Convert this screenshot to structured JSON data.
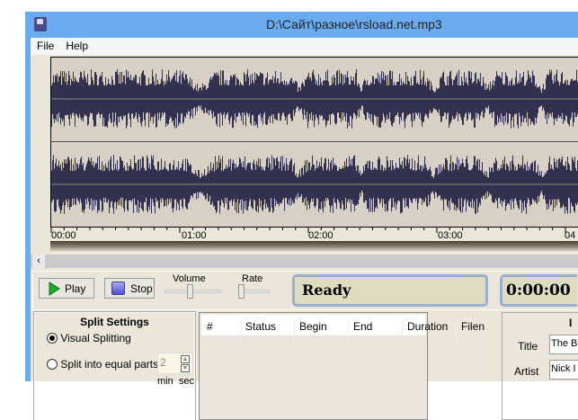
{
  "window": {
    "title": "D:\\Сайт\\разное\\rsload.net.mp3"
  },
  "menu": [
    "File",
    "Help"
  ],
  "timeline": {
    "ticks": [
      "00:00",
      "01:00",
      "02:00",
      "03:00",
      "04"
    ]
  },
  "controls": {
    "play": "Play",
    "stop": "Stop",
    "volume_label": "Volume",
    "rate_label": "Rate",
    "volume": 0.5,
    "rate": 0.05,
    "status": "Ready",
    "time": "0:00:00"
  },
  "split_settings": {
    "title": "Split Settings",
    "visual": "Visual Splitting",
    "equal": "Split into equal parts",
    "parts_value": "2",
    "min": "min",
    "sec": "sec"
  },
  "segments": {
    "columns": [
      "#",
      "Status",
      "Begin",
      "End",
      "Duration",
      "Filen"
    ]
  },
  "id3": {
    "title_short": "I",
    "title_label": "Title",
    "title_value": "The B",
    "artist_label": "Artist",
    "artist_value": "Nick I"
  },
  "colors": {
    "titlebar": "#6aabf0",
    "wave": "#323250",
    "wave_bg": "#d8d0c4"
  }
}
